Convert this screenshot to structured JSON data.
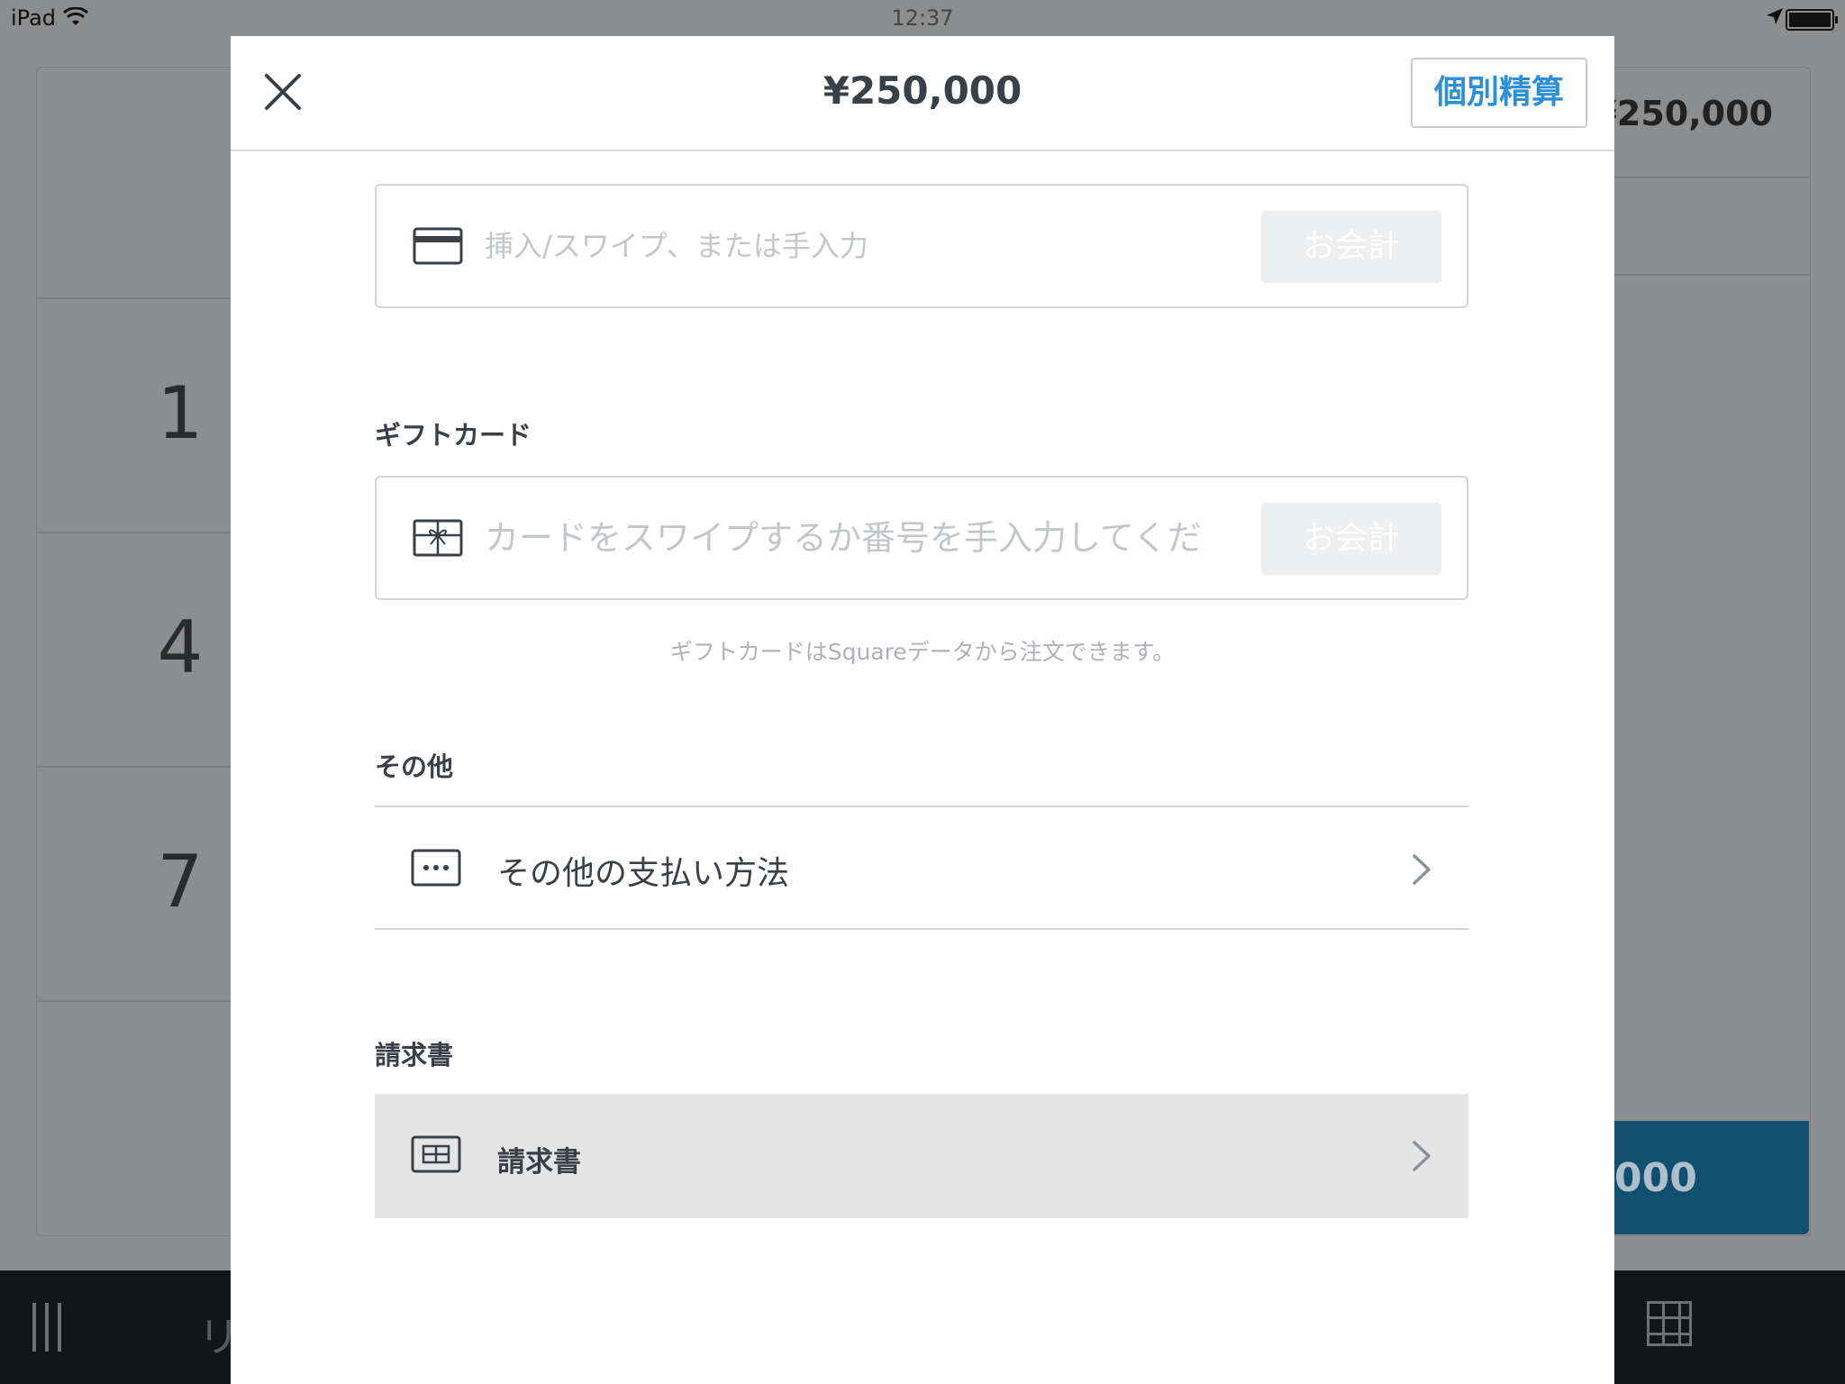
{
  "status_bar": {
    "device": "iPad",
    "time": "12:37"
  },
  "background_app": {
    "keypad_numbers": [
      "1",
      "4",
      "7"
    ],
    "total": "¥250,000",
    "charge_partial": "000",
    "bottom_tab_partial": "リ"
  },
  "modal": {
    "title": "¥250,000",
    "split_label": "個別精算",
    "card_entry": {
      "placeholder": "挿入/スワイプ、または手入力",
      "charge_label": "お会計"
    },
    "gift_card": {
      "section_title": "ギフトカード",
      "placeholder": "カードをスワイプするか番号を手入力してください",
      "charge_label": "お会計",
      "helper": "ギフトカードはSquareデータから注文できます。"
    },
    "other": {
      "section_title": "その他",
      "row_label": "その他の支払い方法"
    },
    "invoice": {
      "section_title": "請求書",
      "row_label": "請求書"
    }
  },
  "colors": {
    "accent": "#2d8fd5",
    "text": "#3b4046",
    "dim_background": "#8c8d8e",
    "charge_bg": "#104f6e"
  }
}
